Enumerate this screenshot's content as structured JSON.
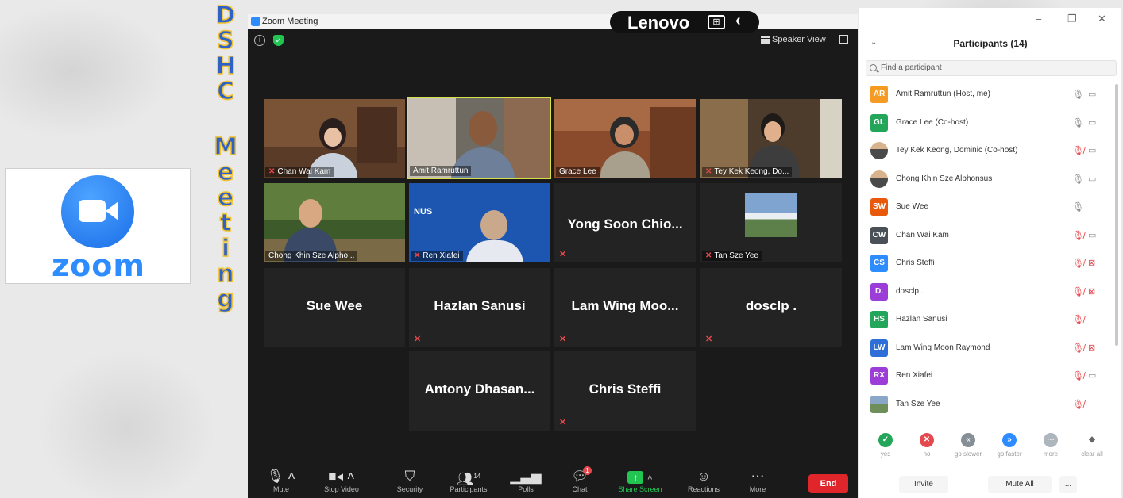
{
  "vertical_title": [
    "D",
    "S",
    "H",
    "C",
    "M",
    "e",
    "e",
    "t",
    "i",
    "n",
    "g"
  ],
  "zoom_logo": {
    "word": "zoom"
  },
  "window": {
    "title": "Zoom Meeting",
    "lenovo": "Lenovo",
    "speaker_view": "Speaker View"
  },
  "tiles": [
    {
      "name": "Chan Wai Kam",
      "video": true,
      "muted": true
    },
    {
      "name": "Amit Ramruttun",
      "video": true,
      "muted": false,
      "active": true
    },
    {
      "name": "Grace Lee",
      "video": true,
      "muted": false
    },
    {
      "name": "Tey Kek Keong, Do...",
      "video": true,
      "muted": true
    },
    {
      "name": "Chong Khin Sze Alpho...",
      "video": true,
      "muted": false
    },
    {
      "name": "Ren Xiafei",
      "video": true,
      "muted": true,
      "logo": "NUS"
    },
    {
      "name": "Yong Soon Chio...",
      "video": false,
      "muted": true
    },
    {
      "name": "Tan Sze Yee",
      "video": true,
      "muted": true
    },
    {
      "name": "Sue Wee",
      "video": false,
      "muted": false
    },
    {
      "name": "Hazlan Sanusi",
      "video": false,
      "muted": true
    },
    {
      "name": "Lam Wing Moo...",
      "video": false,
      "muted": true
    },
    {
      "name": "dosclp .",
      "video": false,
      "muted": true
    },
    {
      "name": "Antony Dhasan...",
      "video": false,
      "muted": false
    },
    {
      "name": "Chris Steffi",
      "video": false,
      "muted": true
    }
  ],
  "toolbar": {
    "mute": "Mute",
    "stop_video": "Stop Video",
    "security": "Security",
    "participants": "Participants",
    "participants_count": "14",
    "polls": "Polls",
    "chat": "Chat",
    "chat_badge": "1",
    "share_screen": "Share Screen",
    "reactions": "Reactions",
    "more": "More",
    "end": "End"
  },
  "panel": {
    "title": "Participants (14)",
    "search_placeholder": "Find a participant",
    "participants": [
      {
        "initials": "AR",
        "color": "#f59a23",
        "name": "Amit Ramruttun (Host, me)",
        "mic": "on",
        "cam": "on"
      },
      {
        "initials": "GL",
        "color": "#23a55a",
        "name": "Grace Lee (Co-host)",
        "mic": "on",
        "cam": "on"
      },
      {
        "initials": "",
        "color": "",
        "avatar": "photo",
        "name": "Tey Kek Keong, Dominic (Co-host)",
        "mic": "off",
        "cam": "on"
      },
      {
        "initials": "",
        "color": "",
        "avatar": "photo",
        "name": "Chong Khin Sze Alphonsus",
        "mic": "on",
        "cam": "on"
      },
      {
        "initials": "SW",
        "color": "#e8590c",
        "name": "Sue Wee",
        "mic": "on",
        "cam": "none"
      },
      {
        "initials": "CW",
        "color": "#495057",
        "name": "Chan Wai Kam",
        "mic": "off",
        "cam": "on"
      },
      {
        "initials": "CS",
        "color": "#2d8cff",
        "name": "Chris Steffi",
        "mic": "off",
        "cam": "off"
      },
      {
        "initials": "D.",
        "color": "#9b3dd6",
        "name": "dosclp .",
        "mic": "off",
        "cam": "off"
      },
      {
        "initials": "HS",
        "color": "#23a55a",
        "name": "Hazlan Sanusi",
        "mic": "off",
        "cam": "none"
      },
      {
        "initials": "LW",
        "color": "#2d6fd6",
        "name": "Lam Wing Moon Raymond",
        "mic": "off",
        "cam": "off"
      },
      {
        "initials": "RX",
        "color": "#9b3dd6",
        "name": "Ren Xiafei",
        "mic": "off",
        "cam": "on"
      },
      {
        "initials": "",
        "color": "",
        "avatar": "landscape",
        "name": "Tan Sze Yee",
        "mic": "off",
        "cam": "none"
      }
    ],
    "reactions": [
      {
        "name": "yes",
        "color": "#23a55a",
        "glyph": "✓"
      },
      {
        "name": "no",
        "color": "#e5484d",
        "glyph": "✕"
      },
      {
        "name": "go slower",
        "color": "#868e96",
        "glyph": "«"
      },
      {
        "name": "go faster",
        "color": "#2d8cff",
        "glyph": "»"
      },
      {
        "name": "more",
        "color": "#adb5bd",
        "glyph": "⋯"
      },
      {
        "name": "clear all",
        "color": "#ffffff",
        "glyph": "◆"
      }
    ],
    "invite": "Invite",
    "mute_all": "Mute All",
    "more": "..."
  },
  "colors": {
    "zoom_blue": "#2d8cff",
    "active_speaker": "#d6e04a",
    "end_red": "#e0262b",
    "share_green": "#23c552"
  }
}
